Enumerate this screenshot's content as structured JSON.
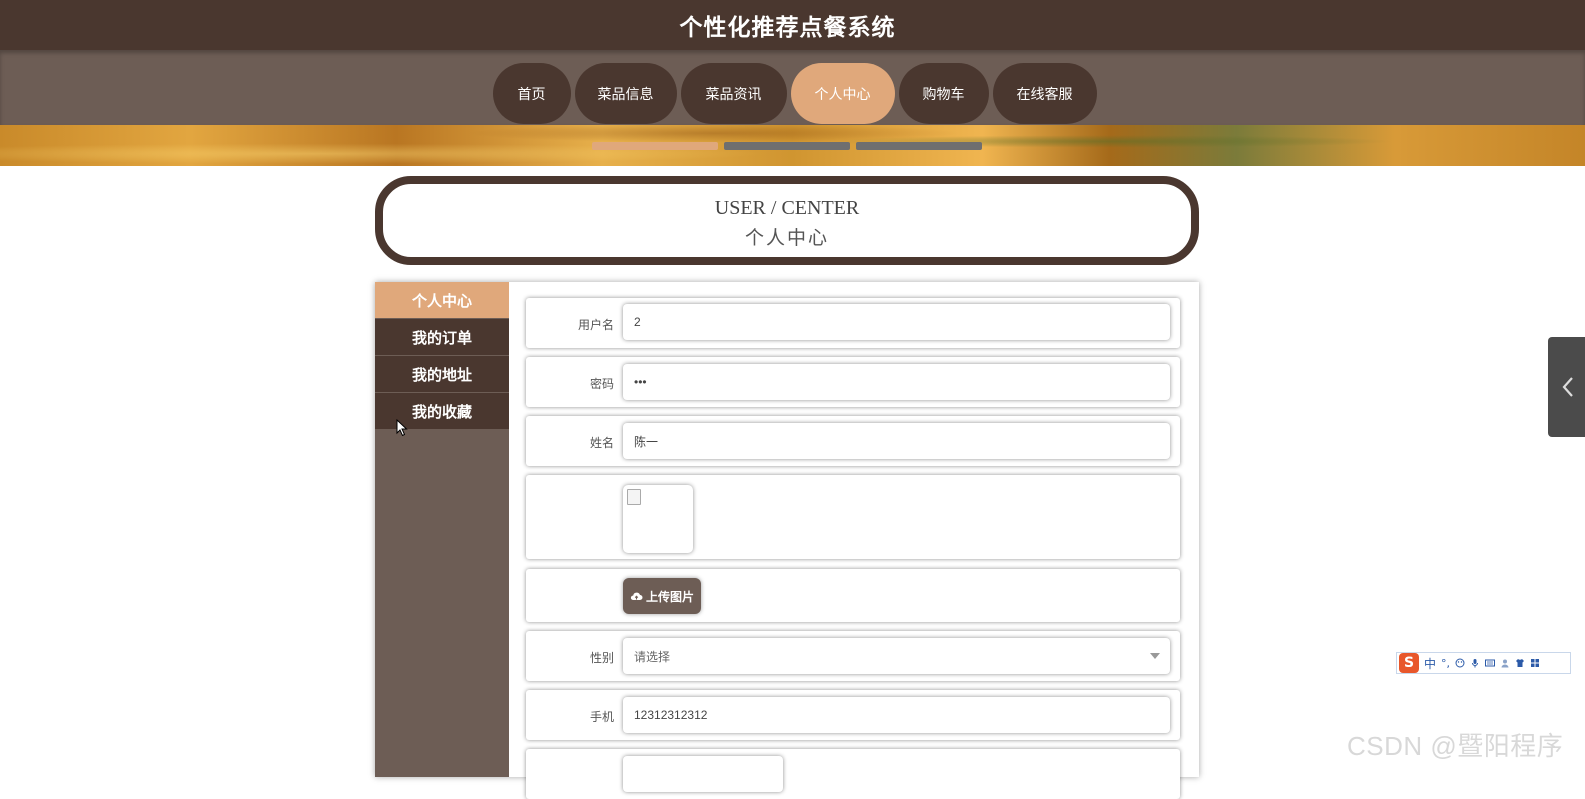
{
  "header": {
    "site_title": "个性化推荐点餐系统"
  },
  "nav": {
    "items": [
      {
        "label": "首页"
      },
      {
        "label": "菜品信息"
      },
      {
        "label": "菜品资讯"
      },
      {
        "label": "个人中心",
        "active": true
      },
      {
        "label": "购物车"
      },
      {
        "label": "在线客服"
      }
    ]
  },
  "banner": {
    "slides": 3,
    "active_slide": 1
  },
  "page_heading": {
    "en": "USER / CENTER",
    "zh": "个人中心"
  },
  "sidebar": {
    "items": [
      {
        "label": "个人中心",
        "active": true
      },
      {
        "label": "我的订单"
      },
      {
        "label": "我的地址"
      },
      {
        "label": "我的收藏"
      }
    ]
  },
  "form": {
    "username": {
      "label": "用户名",
      "value": "2"
    },
    "password": {
      "label": "密码",
      "value": "•••"
    },
    "name": {
      "label": "姓名",
      "value": "陈一"
    },
    "upload": {
      "label": "上传图片"
    },
    "gender": {
      "label": "性别",
      "placeholder": "请选择"
    },
    "phone": {
      "label": "手机",
      "value": "12312312312"
    }
  },
  "ime_toolbar": {
    "logo": "S",
    "mode": "中"
  },
  "watermark": "CSDN @暨阳程序",
  "colors": {
    "primary_dark": "#4a372f",
    "secondary": "#6d5d55",
    "accent": "#e0a87b"
  }
}
